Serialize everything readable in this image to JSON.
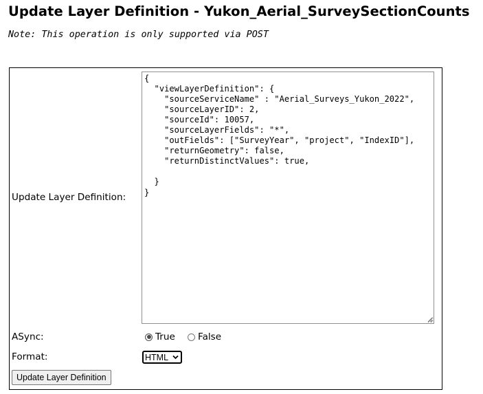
{
  "page": {
    "title": "Update Layer Definition - Yukon_Aerial_SurveySectionCounts",
    "note": "Note: This operation is only supported via POST"
  },
  "form": {
    "definition_label": "Update Layer Definition:",
    "definition_value": "{\n  \"viewLayerDefinition\": {\n    \"sourceServiceName\" : \"Aerial_Surveys_Yukon_2022\",\n    \"sourceLayerID\": 2,\n    \"sourceId\": 10057,\n    \"sourceLayerFields\": \"*\",\n    \"outFields\": [\"SurveyYear\", \"project\", \"IndexID\"],\n    \"returnGeometry\": false,\n    \"returnDistinctValues\": true,\n\n  }\n}",
    "async_label": "ASync:",
    "async_options": [
      {
        "label": "True",
        "checked": true
      },
      {
        "label": "False",
        "checked": false
      }
    ],
    "format_label": "Format:",
    "format_selected": "HTML",
    "submit_label": "Update Layer Definition"
  }
}
